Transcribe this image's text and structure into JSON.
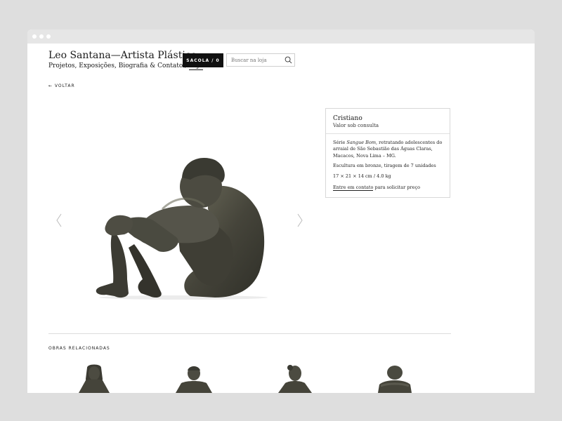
{
  "site": {
    "title": "Leo Santana—Artista Plástico",
    "nav": {
      "prefix": "Projetos, Exposições, Biografia & Contato / ",
      "current": "Loja"
    }
  },
  "header": {
    "bag_label": "SACOLA / 0",
    "search_placeholder": "Buscar na loja"
  },
  "back_label": "← VOLTAR",
  "product": {
    "name": "Cristiano",
    "price": "Valor sob consulta",
    "description_prefix": "Série ",
    "series": "Sangue Bom",
    "description_suffix": ", retratando adolescentes do arraial de São Sebastião das Águas Claras, Macacos, Nova Lima – MG.",
    "material": "Escultura em bronze, tiragem de 7 unidades",
    "dimensions": "17 × 21 × 14 cm / 4.0 kg",
    "contact_link": "Entre em contato",
    "contact_suffix": " para solicitar preço"
  },
  "related": {
    "title": "OBRAS RELACIONADAS",
    "count": 4
  },
  "icons": {
    "search": "search-icon",
    "prev": "chevron-left-icon",
    "next": "chevron-right-icon"
  },
  "colors": {
    "background": "#dedede",
    "page": "#ffffff",
    "button": "#111111",
    "bronze": "#4a4a3f"
  }
}
